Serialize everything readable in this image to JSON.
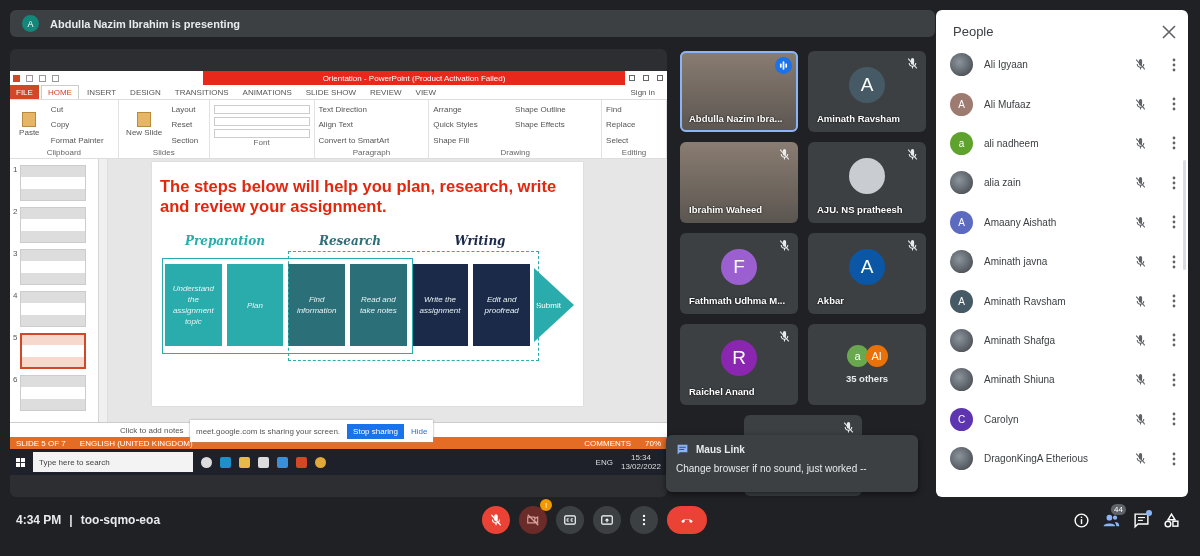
{
  "presenting_banner": {
    "initial": "A",
    "text": "Abdulla Nazim Ibrahim is presenting"
  },
  "shared_screen": {
    "window_title": "Orientation - PowerPoint (Product Activation Failed)",
    "sign_in": "Sign in",
    "ribbon_tabs": [
      {
        "label": "FILE",
        "kind": "file",
        "selected": false
      },
      {
        "label": "HOME",
        "kind": "tab",
        "selected": true
      },
      {
        "label": "INSERT",
        "kind": "tab",
        "selected": false
      },
      {
        "label": "DESIGN",
        "kind": "tab",
        "selected": false
      },
      {
        "label": "TRANSITIONS",
        "kind": "tab",
        "selected": false
      },
      {
        "label": "ANIMATIONS",
        "kind": "tab",
        "selected": false
      },
      {
        "label": "SLIDE SHOW",
        "kind": "tab",
        "selected": false
      },
      {
        "label": "REVIEW",
        "kind": "tab",
        "selected": false
      },
      {
        "label": "VIEW",
        "kind": "tab",
        "selected": false
      }
    ],
    "ribbon_groups": [
      {
        "label": "Clipboard",
        "commands": [
          "Paste",
          "Cut",
          "Copy",
          "Format Painter"
        ]
      },
      {
        "label": "Slides",
        "commands": [
          "New Slide",
          "Layout",
          "Reset",
          "Section"
        ]
      },
      {
        "label": "Font"
      },
      {
        "label": "Paragraph",
        "commands": [
          "Text Direction",
          "Align Text",
          "Convert to SmartArt"
        ]
      },
      {
        "label": "Drawing",
        "commands": [
          "Arrange",
          "Quick Styles",
          "Shape Fill",
          "Shape Outline",
          "Shape Effects"
        ]
      },
      {
        "label": "Editing",
        "commands": [
          "Find",
          "Replace",
          "Select"
        ]
      }
    ],
    "thumbnails": [
      {
        "number": "1",
        "selected": false
      },
      {
        "number": "2",
        "selected": false
      },
      {
        "number": "3",
        "selected": false
      },
      {
        "number": "4",
        "selected": false
      },
      {
        "number": "5",
        "selected": true
      },
      {
        "number": "6",
        "selected": false
      }
    ],
    "slide": {
      "title": "The steps below will help you plan, research, write and review your assignment.",
      "stages": [
        {
          "label": "Preparation",
          "color": "#2aacac"
        },
        {
          "label": "Research",
          "color": "#2b6f78"
        },
        {
          "label": "Writing",
          "color": "#1c2a4a"
        }
      ],
      "steps": [
        {
          "text": "Understand the assignment topic",
          "color": "#2aacac"
        },
        {
          "text": "Plan",
          "color": "#2aacac"
        },
        {
          "text": "Find information",
          "color": "#2b6f78"
        },
        {
          "text": "Read and take notes",
          "color": "#2b6f78"
        },
        {
          "text": "Write the assignment",
          "color": "#1c2a4a"
        },
        {
          "text": "Edit and proofread",
          "color": "#1c2a4a"
        }
      ],
      "final_step": "Submit"
    },
    "notes_placeholder": "Click to add notes",
    "share_bar": {
      "message": "meet.google.com is sharing your screen.",
      "stop_button": "Stop sharing",
      "hide_link": "Hide"
    },
    "status_bar": {
      "slide_count": "SLIDE 5 OF 7",
      "language": "ENGLISH (UNITED KINGDOM)",
      "comments": "COMMENTS",
      "zoom": "70%"
    },
    "taskbar": {
      "search_placeholder": "Type here to search",
      "language": "ENG",
      "time": "15:34",
      "date": "13/02/2022"
    }
  },
  "tiles": [
    {
      "kind": "video",
      "name": "Abdulla Nazim Ibra...",
      "muted": false,
      "speaking": true
    },
    {
      "kind": "initial",
      "name": "Aminath Ravsham",
      "initial": "A",
      "color": "#455a64",
      "muted": true,
      "speaking": false
    },
    {
      "kind": "video",
      "name": "Ibrahim Waheed",
      "muted": true,
      "speaking": false
    },
    {
      "kind": "photo",
      "name": "AJU. NS pratheesh",
      "muted": true,
      "speaking": false
    },
    {
      "kind": "initial",
      "name": "Fathmath Udhma M...",
      "initial": "F",
      "color": "#9c5fd0",
      "muted": true,
      "speaking": false
    },
    {
      "kind": "initial",
      "name": "Akbar",
      "initial": "A",
      "color": "#0b57a5",
      "muted": true,
      "speaking": false
    },
    {
      "kind": "initial",
      "name": "Raichel Anand",
      "initial": "R",
      "color": "#8b26b0",
      "muted": true,
      "speaking": false
    },
    {
      "kind": "others",
      "name": "35 others",
      "avatars": [
        {
          "initial": "a",
          "color": "#6aa84f"
        },
        {
          "initial": "Al",
          "color": "#e8710a"
        }
      ],
      "muted": false,
      "speaking": false
    },
    {
      "kind": "blank",
      "muted": true,
      "speaking": false
    }
  ],
  "chat_toast": {
    "sender": "Maus Link",
    "message": "Change browser if no sound, just worked --"
  },
  "people_panel": {
    "title": "People",
    "people": [
      {
        "name": "Ali Igyaan",
        "kind": "photo",
        "muted": true
      },
      {
        "name": "Ali Mufaaz",
        "kind": "initial",
        "initial": "A",
        "color": "#9d7b70",
        "muted": true
      },
      {
        "name": "ali nadheem",
        "kind": "initial",
        "initial": "a",
        "color": "#5fa32e",
        "muted": true
      },
      {
        "name": "alia zain",
        "kind": "photo",
        "muted": true
      },
      {
        "name": "Amaany Aishath",
        "kind": "initial",
        "initial": "A",
        "color": "#5c6bc0",
        "muted": true
      },
      {
        "name": "Aminath javna",
        "kind": "photo",
        "muted": true
      },
      {
        "name": "Aminath Ravsham",
        "kind": "initial",
        "initial": "A",
        "color": "#455a64",
        "muted": true
      },
      {
        "name": "Aminath Shafga",
        "kind": "photo",
        "muted": true
      },
      {
        "name": "Aminath Shiuna",
        "kind": "photo",
        "muted": true
      },
      {
        "name": "Carolyn",
        "kind": "initial",
        "initial": "C",
        "color": "#5e35b1",
        "muted": true
      },
      {
        "name": "DragonKingA Etherious",
        "kind": "photo",
        "muted": true
      }
    ]
  },
  "toolbar": {
    "time": "4:34 PM",
    "separator": "|",
    "meeting_code": "too-sqmo-eoa",
    "mic_on": false,
    "camera_on": false,
    "camera_alert": "!",
    "people_count": "44",
    "chat_unread": true
  }
}
